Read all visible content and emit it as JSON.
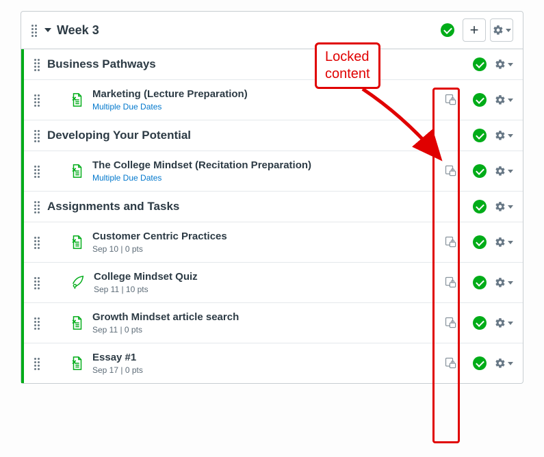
{
  "module": {
    "title": "Week 3"
  },
  "sections": [
    {
      "title": "Business Pathways",
      "items": [
        {
          "title": "Marketing (Lecture Preparation)",
          "sub": "Multiple Due Dates",
          "sublink": true,
          "icon": "page"
        }
      ]
    },
    {
      "title": "Developing Your Potential",
      "items": [
        {
          "title": "The College Mindset (Recitation Preparation)",
          "sub": "Multiple Due Dates",
          "sublink": true,
          "icon": "page"
        }
      ]
    },
    {
      "title": "Assignments and Tasks",
      "items": [
        {
          "title": "Customer Centric Practices",
          "sub": "Sep 10  |  0 pts",
          "icon": "page"
        },
        {
          "title": "College Mindset Quiz",
          "sub": "Sep 11  |  10 pts",
          "icon": "quiz"
        },
        {
          "title": "Growth Mindset article search",
          "sub": "Sep 11  |  0 pts",
          "icon": "page"
        },
        {
          "title": "Essay #1",
          "sub": "Sep 17  |  0 pts",
          "icon": "page"
        }
      ]
    }
  ],
  "callout": {
    "line1": "Locked",
    "line2": "content"
  }
}
